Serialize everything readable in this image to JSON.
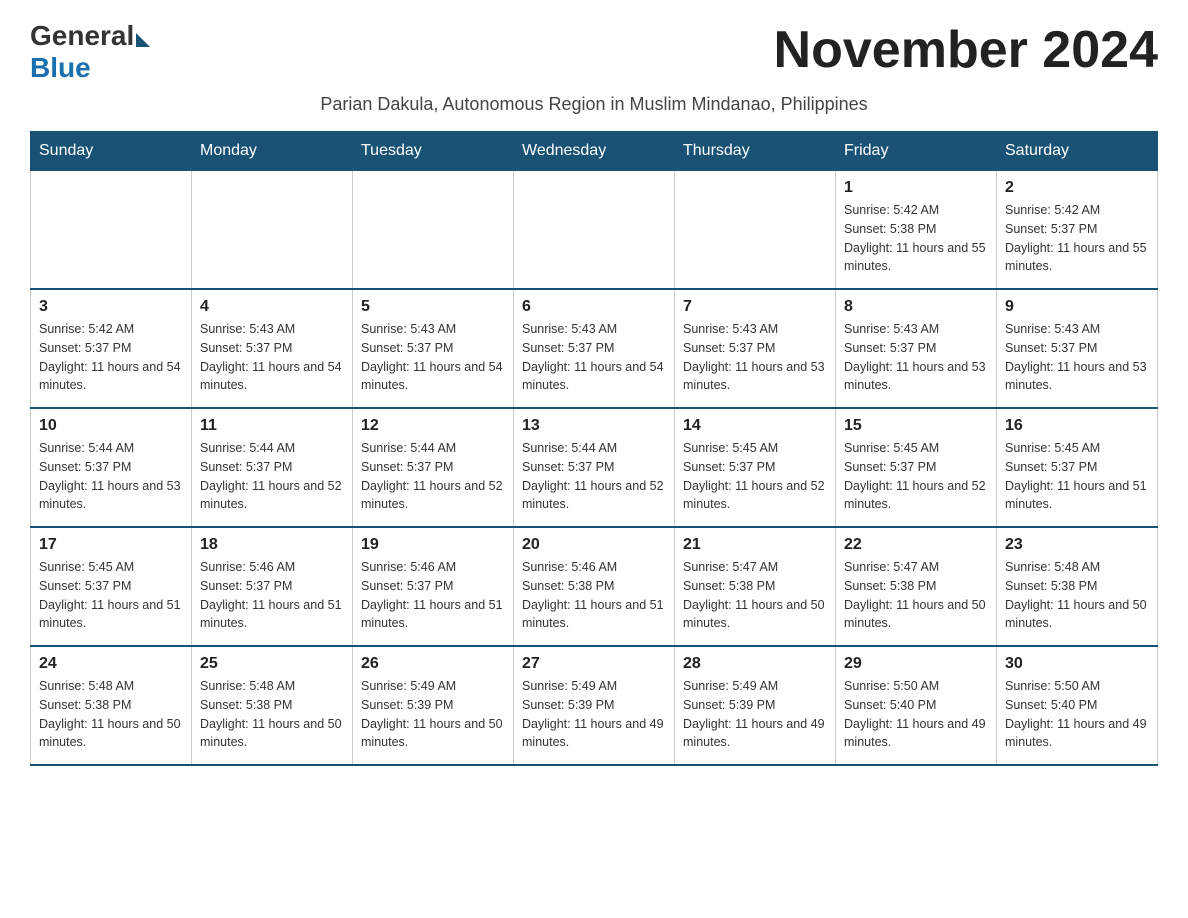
{
  "logo": {
    "general": "General",
    "blue": "Blue"
  },
  "title": "November 2024",
  "subtitle": "Parian Dakula, Autonomous Region in Muslim Mindanao, Philippines",
  "headers": [
    "Sunday",
    "Monday",
    "Tuesday",
    "Wednesday",
    "Thursday",
    "Friday",
    "Saturday"
  ],
  "weeks": [
    [
      {
        "day": "",
        "info": ""
      },
      {
        "day": "",
        "info": ""
      },
      {
        "day": "",
        "info": ""
      },
      {
        "day": "",
        "info": ""
      },
      {
        "day": "",
        "info": ""
      },
      {
        "day": "1",
        "info": "Sunrise: 5:42 AM\nSunset: 5:38 PM\nDaylight: 11 hours and 55 minutes."
      },
      {
        "day": "2",
        "info": "Sunrise: 5:42 AM\nSunset: 5:37 PM\nDaylight: 11 hours and 55 minutes."
      }
    ],
    [
      {
        "day": "3",
        "info": "Sunrise: 5:42 AM\nSunset: 5:37 PM\nDaylight: 11 hours and 54 minutes."
      },
      {
        "day": "4",
        "info": "Sunrise: 5:43 AM\nSunset: 5:37 PM\nDaylight: 11 hours and 54 minutes."
      },
      {
        "day": "5",
        "info": "Sunrise: 5:43 AM\nSunset: 5:37 PM\nDaylight: 11 hours and 54 minutes."
      },
      {
        "day": "6",
        "info": "Sunrise: 5:43 AM\nSunset: 5:37 PM\nDaylight: 11 hours and 54 minutes."
      },
      {
        "day": "7",
        "info": "Sunrise: 5:43 AM\nSunset: 5:37 PM\nDaylight: 11 hours and 53 minutes."
      },
      {
        "day": "8",
        "info": "Sunrise: 5:43 AM\nSunset: 5:37 PM\nDaylight: 11 hours and 53 minutes."
      },
      {
        "day": "9",
        "info": "Sunrise: 5:43 AM\nSunset: 5:37 PM\nDaylight: 11 hours and 53 minutes."
      }
    ],
    [
      {
        "day": "10",
        "info": "Sunrise: 5:44 AM\nSunset: 5:37 PM\nDaylight: 11 hours and 53 minutes."
      },
      {
        "day": "11",
        "info": "Sunrise: 5:44 AM\nSunset: 5:37 PM\nDaylight: 11 hours and 52 minutes."
      },
      {
        "day": "12",
        "info": "Sunrise: 5:44 AM\nSunset: 5:37 PM\nDaylight: 11 hours and 52 minutes."
      },
      {
        "day": "13",
        "info": "Sunrise: 5:44 AM\nSunset: 5:37 PM\nDaylight: 11 hours and 52 minutes."
      },
      {
        "day": "14",
        "info": "Sunrise: 5:45 AM\nSunset: 5:37 PM\nDaylight: 11 hours and 52 minutes."
      },
      {
        "day": "15",
        "info": "Sunrise: 5:45 AM\nSunset: 5:37 PM\nDaylight: 11 hours and 52 minutes."
      },
      {
        "day": "16",
        "info": "Sunrise: 5:45 AM\nSunset: 5:37 PM\nDaylight: 11 hours and 51 minutes."
      }
    ],
    [
      {
        "day": "17",
        "info": "Sunrise: 5:45 AM\nSunset: 5:37 PM\nDaylight: 11 hours and 51 minutes."
      },
      {
        "day": "18",
        "info": "Sunrise: 5:46 AM\nSunset: 5:37 PM\nDaylight: 11 hours and 51 minutes."
      },
      {
        "day": "19",
        "info": "Sunrise: 5:46 AM\nSunset: 5:37 PM\nDaylight: 11 hours and 51 minutes."
      },
      {
        "day": "20",
        "info": "Sunrise: 5:46 AM\nSunset: 5:38 PM\nDaylight: 11 hours and 51 minutes."
      },
      {
        "day": "21",
        "info": "Sunrise: 5:47 AM\nSunset: 5:38 PM\nDaylight: 11 hours and 50 minutes."
      },
      {
        "day": "22",
        "info": "Sunrise: 5:47 AM\nSunset: 5:38 PM\nDaylight: 11 hours and 50 minutes."
      },
      {
        "day": "23",
        "info": "Sunrise: 5:48 AM\nSunset: 5:38 PM\nDaylight: 11 hours and 50 minutes."
      }
    ],
    [
      {
        "day": "24",
        "info": "Sunrise: 5:48 AM\nSunset: 5:38 PM\nDaylight: 11 hours and 50 minutes."
      },
      {
        "day": "25",
        "info": "Sunrise: 5:48 AM\nSunset: 5:38 PM\nDaylight: 11 hours and 50 minutes."
      },
      {
        "day": "26",
        "info": "Sunrise: 5:49 AM\nSunset: 5:39 PM\nDaylight: 11 hours and 50 minutes."
      },
      {
        "day": "27",
        "info": "Sunrise: 5:49 AM\nSunset: 5:39 PM\nDaylight: 11 hours and 49 minutes."
      },
      {
        "day": "28",
        "info": "Sunrise: 5:49 AM\nSunset: 5:39 PM\nDaylight: 11 hours and 49 minutes."
      },
      {
        "day": "29",
        "info": "Sunrise: 5:50 AM\nSunset: 5:40 PM\nDaylight: 11 hours and 49 minutes."
      },
      {
        "day": "30",
        "info": "Sunrise: 5:50 AM\nSunset: 5:40 PM\nDaylight: 11 hours and 49 minutes."
      }
    ]
  ]
}
